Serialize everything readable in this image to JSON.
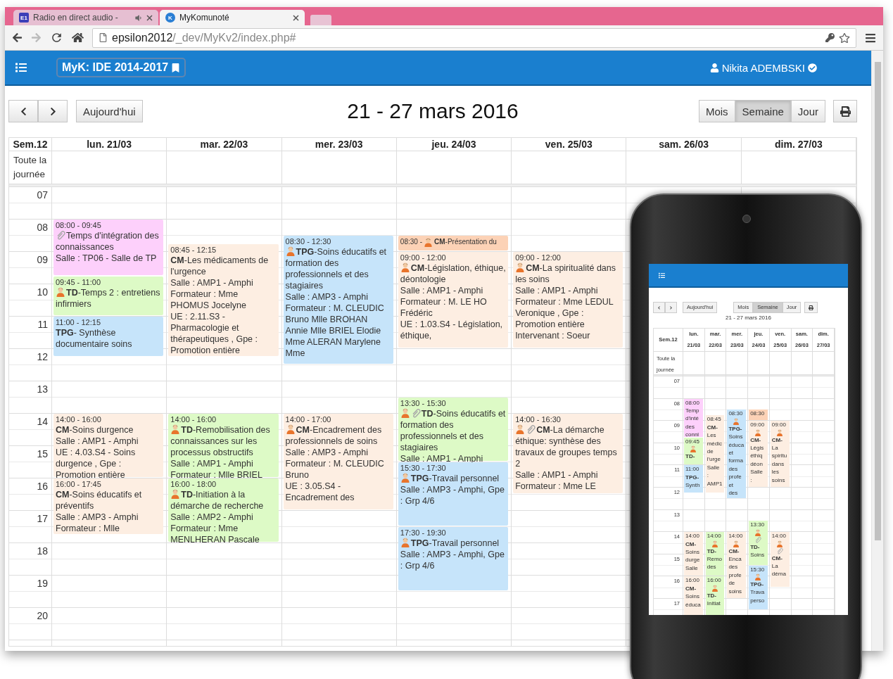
{
  "browser": {
    "tabs": [
      {
        "favicon": "E1",
        "label": "Radio en direct audio -",
        "audio": true,
        "selected": false
      },
      {
        "favicon": "K",
        "label": "MyKomunoté",
        "selected": true
      }
    ],
    "address": {
      "host": "epsilon2012",
      "path": "/_dev/MyKv2/index.php#"
    }
  },
  "navbar": {
    "brand": "MyK: IDE 2014-2017",
    "user": "Nikita ADEMBSKI"
  },
  "toolbar": {
    "today": "Aujourd'hui",
    "title": "21 - 27 mars 2016",
    "views": [
      {
        "label": "Mois",
        "selected": false
      },
      {
        "label": "Semaine",
        "selected": true
      },
      {
        "label": "Jour",
        "selected": false
      }
    ]
  },
  "calendar": {
    "week": "Sem.12",
    "all_day": "Toute la journée",
    "hours": [
      "07",
      "08",
      "09",
      "10",
      "11",
      "12",
      "13",
      "14",
      "15",
      "16",
      "17",
      "18",
      "19",
      "20"
    ],
    "days": [
      {
        "label": "lun. 21/03",
        "events": [
          {
            "time": "08:00 - 09:45",
            "color": "#fdd0fb",
            "clip": true,
            "title": "Temps d'intégration des connaissances",
            "details": [
              "Salle : TP06 - Salle de TP"
            ]
          },
          {
            "time": "09:45 - 11:00",
            "color": "#ddfac6",
            "person": true,
            "title": "**TD**-Temps 2 : entretiens infirmiers"
          },
          {
            "time": "11:00 - 12:15",
            "color": "#c6e4fa",
            "title": "**TPG**- Synthèse documentaire soins"
          },
          {
            "time": "14:00 - 16:00",
            "color": "#fdeee2",
            "title": "**CM**-Soins durgence",
            "details": [
              "Salle : AMP1 - Amphi",
              "UE : 4.03.S4 - Soins durgence , Gpe : Promotion entière"
            ]
          },
          {
            "time": "16:00 - 17:45",
            "color": "#fdeee2",
            "title": "**CM**-Soins éducatifs et préventifs",
            "details": [
              "Salle : AMP3 - Amphi",
              "Formateur : Mlle"
            ]
          }
        ]
      },
      {
        "label": "mar. 22/03",
        "events": [
          {
            "time": "08:45 - 12:15",
            "color": "#fdeee2",
            "title": "**CM**-Les médicaments de l'urgence",
            "details": [
              "Salle : AMP1 - Amphi",
              "Formateur : Mme PHOMUS Jocelyne",
              "UE : 2.11.S3 - Pharmacologie et thérapeutiques , Gpe : Promotion entière"
            ]
          },
          {
            "time": "14:00 - 16:00",
            "color": "#ddfac6",
            "person": true,
            "title": "**TD**-Remobilisation des connaissances sur les processus obstructifs",
            "details": [
              "Salle : AMP1 - Amphi",
              "Formateur : Mlle BRIEL"
            ]
          },
          {
            "time": "16:00 - 18:00",
            "color": "#ddfac6",
            "person": true,
            "title": "**TD**-Initiation à la démarche de recherche",
            "details": [
              "Salle : AMP2 - Amphi",
              "Formateur : Mme MENLHERAN Pascale"
            ]
          }
        ]
      },
      {
        "label": "mer. 23/03",
        "events": [
          {
            "time": "08:30 - 12:30",
            "color": "#c6e4fa",
            "person": true,
            "title": "**TPG**-Soins éducatifs et formation des professionnels et des stagiaires",
            "details": [
              "Salle : AMP3 - Amphi",
              "Formateur : M. CLEUDIC Bruno Mlle BROHAN Annie Mlle BRIEL Elodie Mme ALERAN Marylene Mme"
            ]
          },
          {
            "time": "14:00 - 17:00",
            "color": "#fdeee2",
            "person": true,
            "title": "**CM**-Encadrement des professionnels de soins",
            "details": [
              "Salle : AMP3 - Amphi",
              "Formateur : M. CLEUDIC Bruno",
              "UE : 3.05.S4 - Encadrement des"
            ]
          }
        ]
      },
      {
        "label": "jeu. 24/03",
        "events": [
          {
            "time": "08:30 -",
            "color": "#fcd2b6",
            "person": true,
            "title": "**CM**-Présentation du"
          },
          {
            "time": "09:00 - 12:00",
            "color": "#fdeee2",
            "person": true,
            "title": "**CM**-Législation, éthique, déontologie",
            "details": [
              "Salle : AMP1 - Amphi",
              "Formateur : M. LE HO Frédéric",
              "UE : 1.03.S4 - Législation, éthique,"
            ]
          },
          {
            "time": "13:30 - 15:30",
            "color": "#ddfac6",
            "person": true,
            "clip": true,
            "title": "**TD**-Soins éducatifs et formation des professionnels et des stagiaires",
            "details": [
              "Salle : AMP1 - Amphi"
            ]
          },
          {
            "time": "15:30 - 17:30",
            "color": "#c6e4fa",
            "person": true,
            "title": "**TPG**-Travail personnel",
            "details": [
              "Salle : AMP3 - Amphi, Gpe : Grp 4/6"
            ]
          },
          {
            "time": "17:30 - 19:30",
            "color": "#c6e4fa",
            "person": true,
            "title": "**TPG**-Travail personnel",
            "details": [
              "Salle : AMP3 - Amphi, Gpe : Grp 4/6"
            ]
          }
        ]
      },
      {
        "label": "ven. 25/03",
        "events": [
          {
            "time": "09:00 - 12:00",
            "color": "#fdeee2",
            "person": true,
            "title": "**CM**-La spiritualité dans les soins",
            "details": [
              "Salle : AMP1 - Amphi",
              "Formateur : Mme LEDUL Veronique , Gpe : Promotion entière",
              "Intervenant : Soeur"
            ]
          },
          {
            "time": "14:00 - 16:30",
            "color": "#fdeee2",
            "person": true,
            "clip": true,
            "title": "**CM**-La démarche éthique: synthèse des travaux de groupes temps 2",
            "details": [
              "Salle : AMP1 - Amphi",
              "Formateur : Mme LE"
            ]
          }
        ]
      },
      {
        "label": "sam. 26/03"
      },
      {
        "label": "dim. 27/03"
      }
    ]
  },
  "phone": {
    "today": "Aujourd'hui",
    "title": "21 - 27 mars 2016",
    "week": "Sem.12",
    "all_day": "Toute la journée",
    "views": [
      {
        "label": "Mois",
        "selected": false
      },
      {
        "label": "Semaine",
        "selected": true
      },
      {
        "label": "Jour",
        "selected": false
      }
    ],
    "hours": [
      "07",
      "08",
      "09",
      "10",
      "11",
      "12",
      "13",
      "14",
      "15",
      "16",
      "17"
    ],
    "days": [
      {
        "name": "lun.",
        "date": "21/03",
        "events": [
          {
            "time": "08:00",
            "lines": [
              "Temp",
              "d'inté",
              "des",
              "conni"
            ]
          },
          {
            "time": "09:45",
            "person": true,
            "code": "TD-"
          },
          {
            "time": "11:00",
            "code": "TPG-",
            "lines": [
              "Synth"
            ]
          },
          {
            "time": "14:00",
            "code": "CM-",
            "lines": [
              "Soins",
              "durge",
              "Salle"
            ]
          },
          {
            "time": "16:00",
            "code": "CM-",
            "lines": [
              "Soins",
              "éduca"
            ]
          }
        ]
      },
      {
        "name": "mar.",
        "date": "22/03",
        "events": [
          {
            "time": "08:45",
            "code": "CM-",
            "lines": [
              "Les",
              "médic",
              "de",
              "l'urge",
              "Salle",
              ":",
              "AMP1"
            ]
          },
          {
            "time": "14:00",
            "person": true,
            "code": "TD-",
            "lines": [
              "Remo",
              "des"
            ]
          },
          {
            "time": "16:00",
            "person": true,
            "code": "TD-",
            "lines": [
              "Initiat"
            ]
          }
        ]
      },
      {
        "name": "mer.",
        "date": "23/03",
        "events": [
          {
            "time": "08:30",
            "person": true,
            "code": "TPG-",
            "lines": [
              "Soins",
              "éduca",
              "et",
              "forma",
              "des",
              "profe",
              "et",
              "des"
            ]
          },
          {
            "time": "14:00",
            "person": true,
            "code": "CM-",
            "lines": [
              "Enca",
              "des",
              "profe",
              "de",
              "soins"
            ]
          }
        ]
      },
      {
        "name": "jeu.",
        "date": "24/03",
        "events": [
          {
            "time": "08:30"
          },
          {
            "time": "09:00",
            "person": true,
            "code": "CM-",
            "lines": [
              "Légis",
              "éthiq",
              "déon",
              "Salle",
              ":"
            ]
          },
          {
            "time": "13:30",
            "person": true,
            "clip": true,
            "code": "TD-",
            "lines": [
              "Soins"
            ]
          },
          {
            "time": "15:30",
            "person": true,
            "code": "TPG-",
            "lines": [
              "Trava",
              "perso"
            ]
          }
        ]
      },
      {
        "name": "ven.",
        "date": "25/03",
        "events": [
          {
            "time": "09:00",
            "person": true,
            "code": "CM-",
            "lines": [
              "La",
              "spiritu",
              "dans",
              "les",
              "soins"
            ]
          },
          {
            "time": "14:00",
            "person": true,
            "clip": true,
            "code": "CM-",
            "lines": [
              "La",
              "déma"
            ]
          }
        ]
      },
      {
        "name": "sam.",
        "date": "26/03"
      },
      {
        "name": "dim.",
        "date": "27/03"
      }
    ]
  }
}
